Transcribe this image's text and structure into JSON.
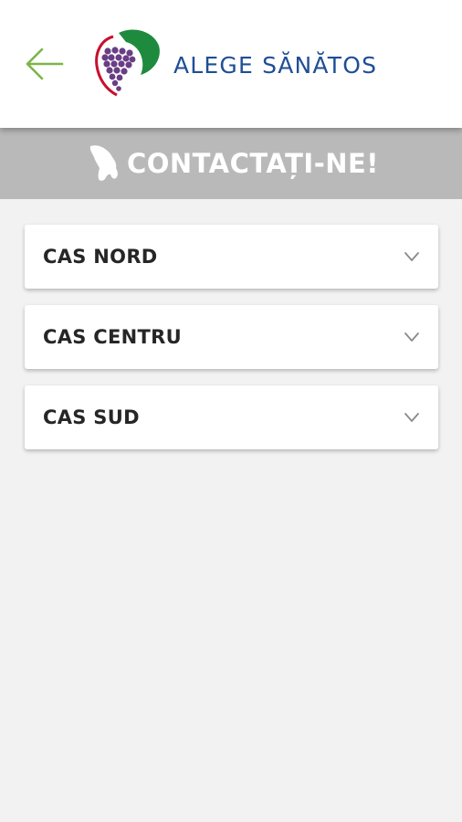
{
  "header": {
    "app_title": "ALEGE SĂNĂTOS",
    "back_icon": "arrow-left-icon",
    "logo_icon": "grapes-logo-icon",
    "accent_color": "#7ab648",
    "title_color": "#1f4e96"
  },
  "banner": {
    "title": "CONTACTAȚI-NE!",
    "icon": "moldova-map-icon",
    "background": "#b9b9b9"
  },
  "sections": [
    {
      "label": "CAS NORD",
      "icon": "chevron-down-icon",
      "expanded": false
    },
    {
      "label": "CAS CENTRU",
      "icon": "chevron-down-icon",
      "expanded": false
    },
    {
      "label": "CAS SUD",
      "icon": "chevron-down-icon",
      "expanded": false
    }
  ]
}
